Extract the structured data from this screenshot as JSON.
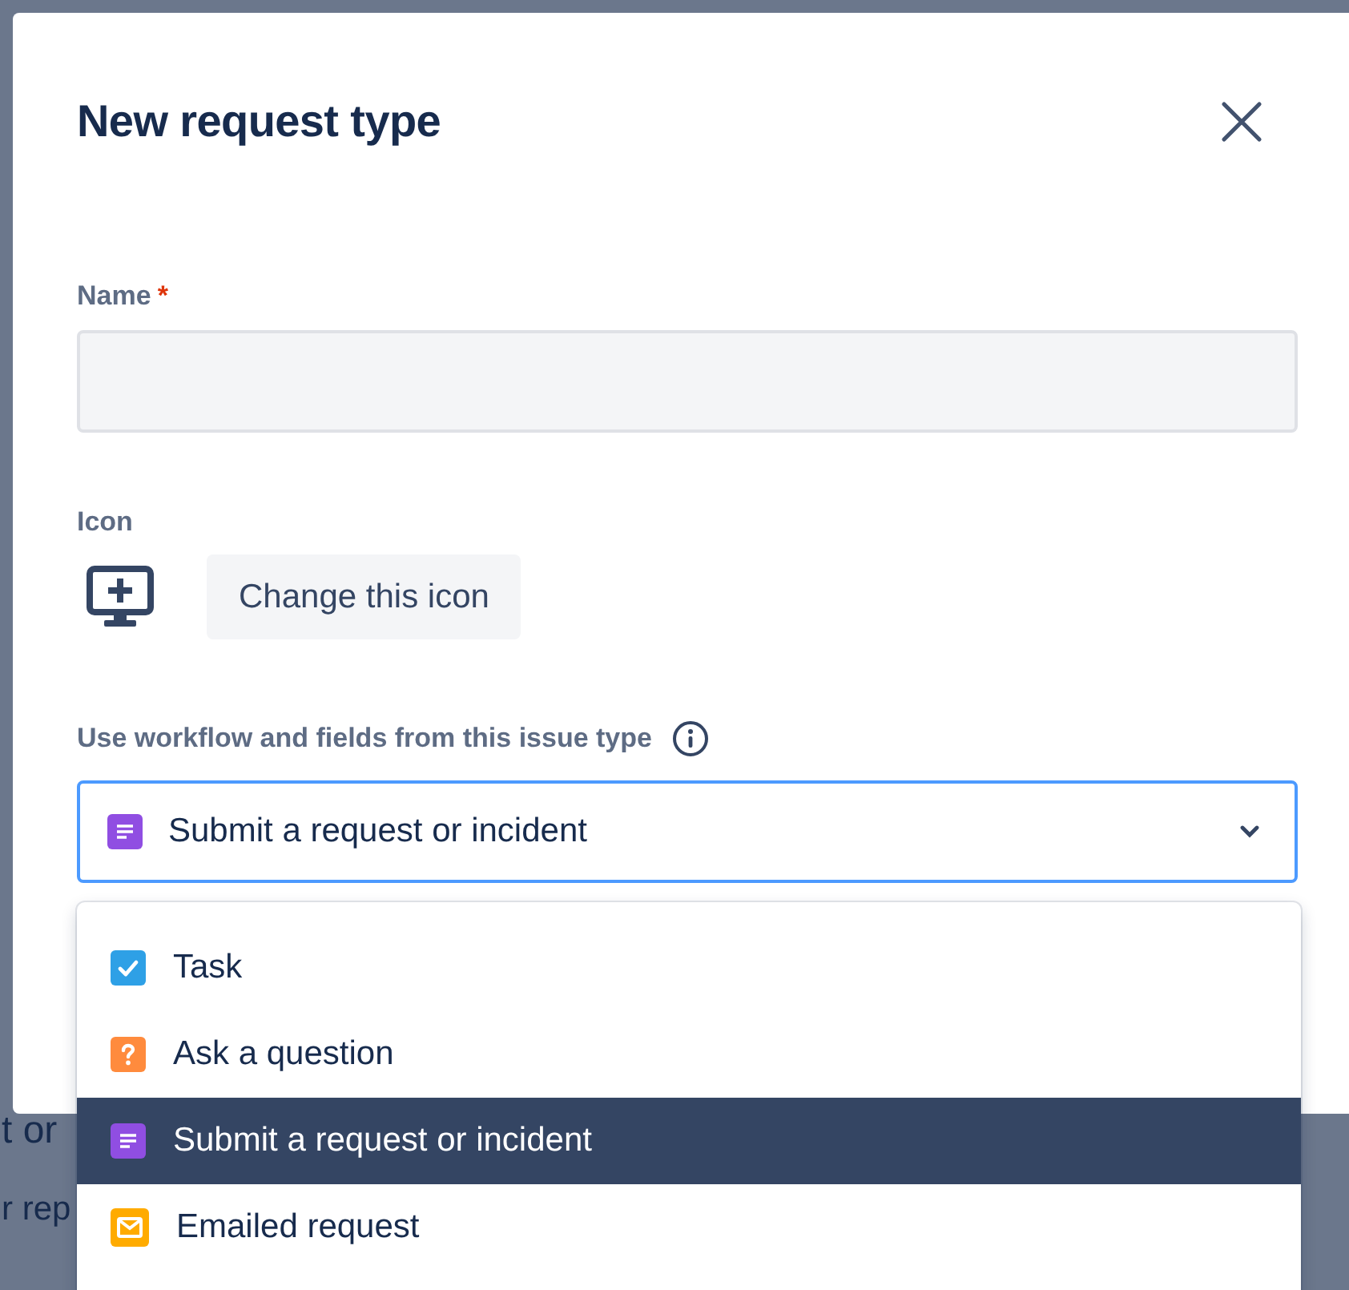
{
  "background": {
    "fragments": [
      "t or",
      "r rep"
    ]
  },
  "dialog": {
    "title": "New request type",
    "name_field": {
      "label": "Name",
      "required_mark": "*"
    },
    "icon_field": {
      "label": "Icon",
      "button": "Change this icon"
    },
    "issue_type": {
      "label": "Use workflow and fields from this issue type",
      "value": "Submit a request or incident",
      "kind": "request",
      "focused": true
    }
  },
  "menu": {
    "items": [
      {
        "label": "Task",
        "kind": "task",
        "selected": false
      },
      {
        "label": "Ask a question",
        "kind": "question",
        "selected": false
      },
      {
        "label": "Submit a request or incident",
        "kind": "request",
        "selected": true
      },
      {
        "label": "Emailed request",
        "kind": "email",
        "selected": false
      }
    ]
  }
}
